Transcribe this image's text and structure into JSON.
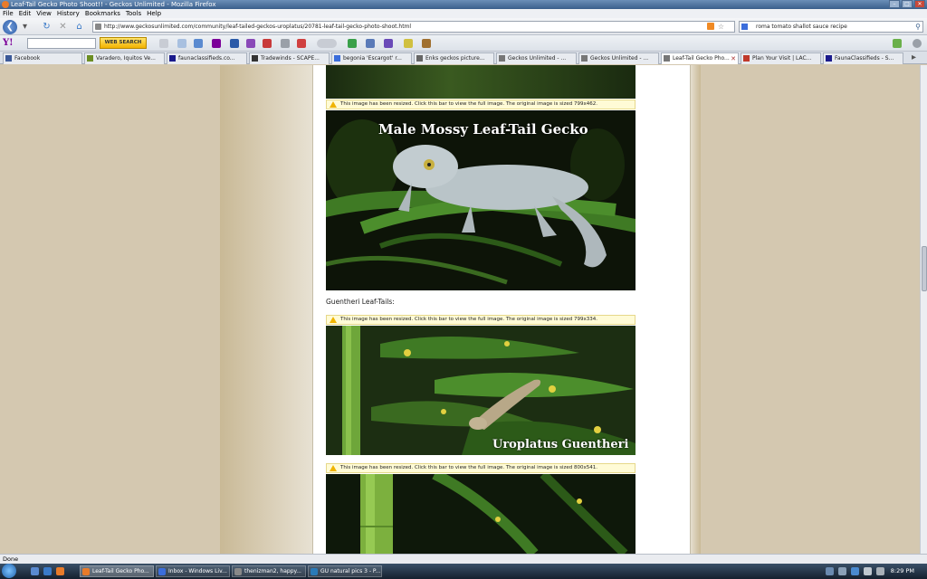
{
  "window": {
    "title": "Leaf-Tail Gecko Photo Shoot!! - Geckos Unlimited - Mozilla Firefox",
    "controls": [
      "–",
      "□",
      "✕"
    ]
  },
  "menu": [
    "File",
    "Edit",
    "View",
    "History",
    "Bookmarks",
    "Tools",
    "Help"
  ],
  "nav": {
    "back_glyph": "❮",
    "url": "http://www.geckosunlimited.com/community/leaf-tailed-geckos-uroplatus/20781-leaf-tail-gecko-photo-shoot.html",
    "search_value": "roma tomato shallot sauce recipe"
  },
  "yahoo_toolbar": {
    "logo": "Y!",
    "search_button": "WEB SEARCH"
  },
  "tabs": [
    {
      "label": "Facebook",
      "color": "#3b5998"
    },
    {
      "label": "Varadero, Iquitos Ve...",
      "color": "#6b8e23"
    },
    {
      "label": "faunaclassifieds.co...",
      "color": "#1a1a8c"
    },
    {
      "label": "Tradewinds - SCAPE...",
      "color": "#333333"
    },
    {
      "label": "begonia 'Escargot' r...",
      "color": "#3b6ddb"
    },
    {
      "label": "Enks geckos picture...",
      "color": "#666666"
    },
    {
      "label": "Geckos Unlimited - ...",
      "color": "#777777"
    },
    {
      "label": "Geckos Unlimited - ...",
      "color": "#777777"
    },
    {
      "label": "Leaf-Tail Gecko Pho...",
      "color": "#777777",
      "active": true
    },
    {
      "label": "Plan Your Visit | LAC...",
      "color": "#c0392b"
    },
    {
      "label": "FaunaClassifieds - S...",
      "color": "#1a1a8c"
    }
  ],
  "content": {
    "resize_notes": [
      "This image has been resized. Click this bar to view the full image. The original image is sized 799x462.",
      "This image has been resized. Click this bar to view the full image. The original image is sized 799x334.",
      "This image has been resized. Click this bar to view the full image. The original image is sized 800x541."
    ],
    "photo1_caption": "Male Mossy Leaf-Tail Gecko",
    "section_heading": "Guentheri Leaf-Tails:",
    "photo2_caption": "Uroplatus Guentheri"
  },
  "status": {
    "text": "Done"
  },
  "taskbar": {
    "tasks": [
      {
        "label": "Leaf-Tail Gecko Pho...",
        "color": "#e87b2a",
        "active": true
      },
      {
        "label": "Inbox - Windows Liv...",
        "color": "#3b6ddb"
      },
      {
        "label": "thenizman2, happy...",
        "color": "#888888"
      },
      {
        "label": "GU natural pics 3 - P...",
        "color": "#2a7ab8"
      }
    ],
    "clock": "8:29 PM"
  }
}
